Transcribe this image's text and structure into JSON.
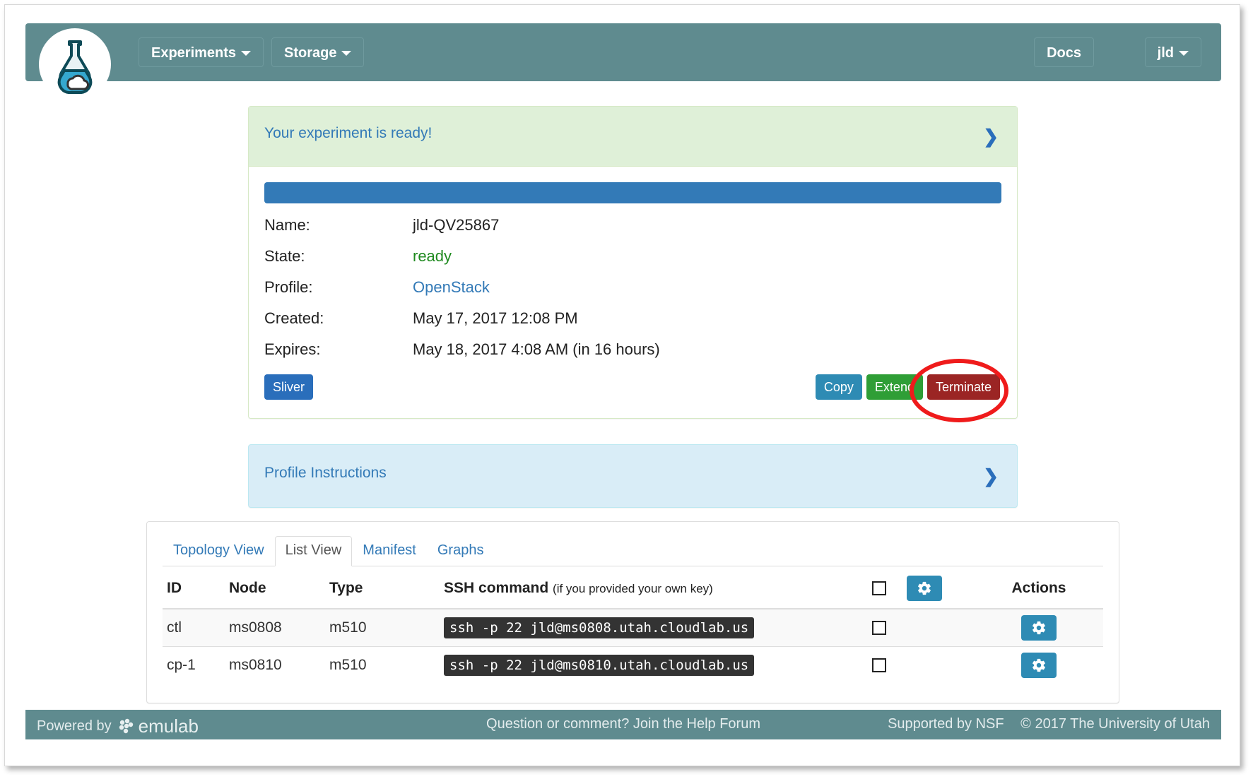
{
  "navbar": {
    "brand_icon": "flask-cloud-logo",
    "items": [
      {
        "label": "Experiments",
        "has_caret": true
      },
      {
        "label": "Storage",
        "has_caret": true
      }
    ],
    "docs_label": "Docs",
    "user_label": "jld",
    "bg_color": "#5f8b8f"
  },
  "experiment": {
    "alert_title": "Your experiment is ready!",
    "alert_bg": "#dff0d8",
    "progress_color": "#337ab7",
    "progress_percent": 100,
    "details": [
      {
        "label": "Name:",
        "value": "jld-QV25867",
        "style": "plain"
      },
      {
        "label": "State:",
        "value": "ready",
        "style": "state"
      },
      {
        "label": "Profile:",
        "value": "OpenStack",
        "style": "link"
      },
      {
        "label": "Created:",
        "value": "May 17, 2017 12:08 PM",
        "style": "plain"
      },
      {
        "label": "Expires:",
        "value": "May 18, 2017 4:08 AM (in 16 hours)",
        "style": "plain"
      }
    ],
    "sliver_label": "Sliver",
    "copy_label": "Copy",
    "extend_label": "Extend",
    "terminate_label": "Terminate",
    "annotation": "red-ellipse-around-terminate",
    "annotation_color": "#ef1b1b"
  },
  "profile_instructions": {
    "title": "Profile Instructions",
    "bg": "#d9edf7"
  },
  "list_view": {
    "tabs": [
      {
        "label": "Topology View",
        "active": false
      },
      {
        "label": "List View",
        "active": true
      },
      {
        "label": "Manifest",
        "active": false
      },
      {
        "label": "Graphs",
        "active": false
      }
    ],
    "columns": {
      "id": "ID",
      "node": "Node",
      "type": "Type",
      "ssh": "SSH command",
      "ssh_note": "(if you provided your own key)",
      "actions": "Actions"
    },
    "rows": [
      {
        "id": "ctl",
        "node": "ms0808",
        "type": "m510",
        "ssh": "ssh -p 22 jld@ms0808.utah.cloudlab.us"
      },
      {
        "id": "cp-1",
        "node": "ms0810",
        "type": "m510",
        "ssh": "ssh -p 22 jld@ms0810.utah.cloudlab.us"
      }
    ]
  },
  "footer": {
    "powered_by": "Powered by",
    "emulab": "emulab",
    "help": "Question or comment? Join the Help Forum",
    "nsf": "Supported by NSF",
    "copyright": "© 2017 The University of Utah"
  }
}
